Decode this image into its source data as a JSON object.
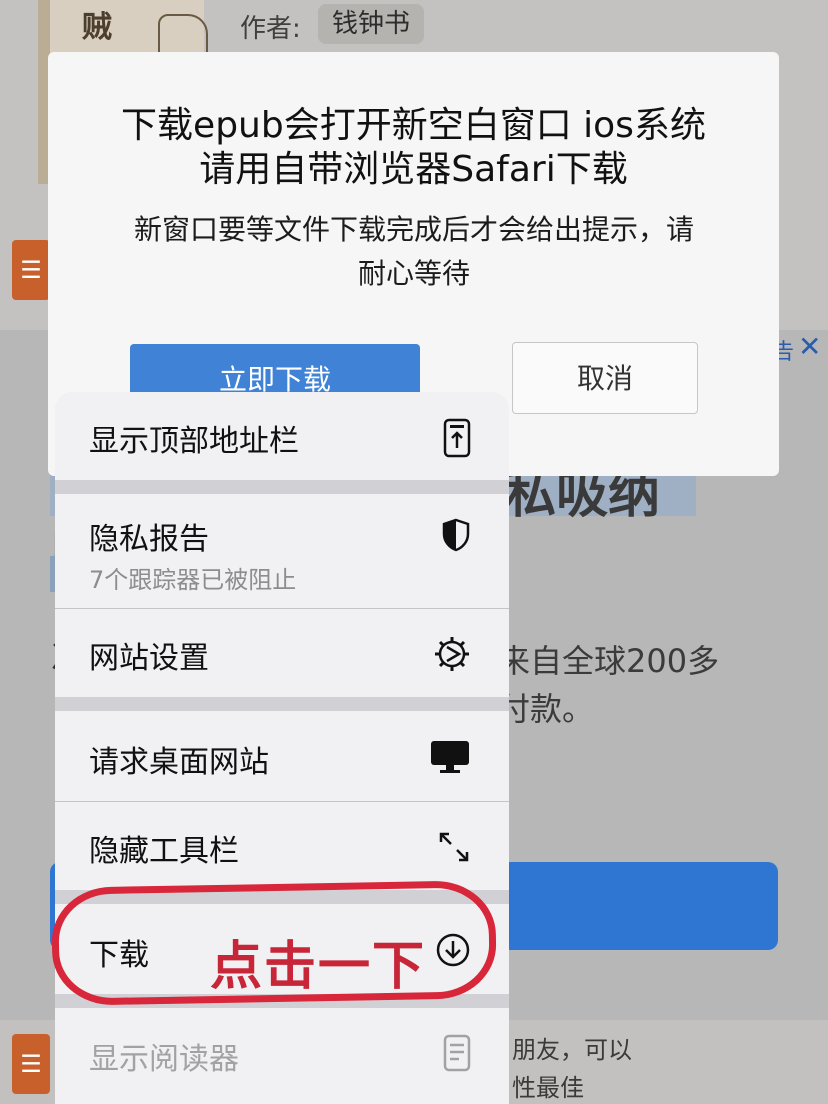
{
  "page": {
    "book_title_glyph": "贼",
    "author_label": "作者:",
    "author_name": "钱钟书",
    "ad": {
      "label": "告",
      "close_icon": "close-icon",
      "headline_fragment": "私吸纳",
      "left_glyph_1": "J",
      "left_glyph_2": "冫",
      "body_line_1": "来自全球200多",
      "body_line_2": "付款。"
    },
    "bottom": {
      "line_1": "朋友，可以",
      "line_2": "性最佳"
    },
    "orange_icon": "book-icon"
  },
  "dialog": {
    "title_line_1": "下载epub会打开新空白窗口 ios系统",
    "title_line_2": "请用自带浏览器Safari下载",
    "message_line_1": "新窗口要等文件下载完成后才会给出提示，请",
    "message_line_2": "耐心等待",
    "download_button": "立即下载",
    "cancel_button": "取消"
  },
  "menu": {
    "items": [
      {
        "label": "显示顶部地址栏",
        "icon": "phone-arrow-up-icon"
      },
      {
        "label": "隐私报告",
        "sublabel": "7个跟踪器已被阻止",
        "icon": "shield-icon"
      },
      {
        "label": "网站设置",
        "icon": "gear-icon"
      },
      {
        "label": "请求桌面网站",
        "icon": "desktop-icon"
      },
      {
        "label": "隐藏工具栏",
        "icon": "expand-arrows-icon"
      },
      {
        "label": "下载",
        "icon": "download-circle-icon"
      },
      {
        "label": "显示阅读器",
        "icon": "reader-icon"
      }
    ]
  },
  "annotation": {
    "text": "点击一下",
    "color": "#d8263a"
  }
}
